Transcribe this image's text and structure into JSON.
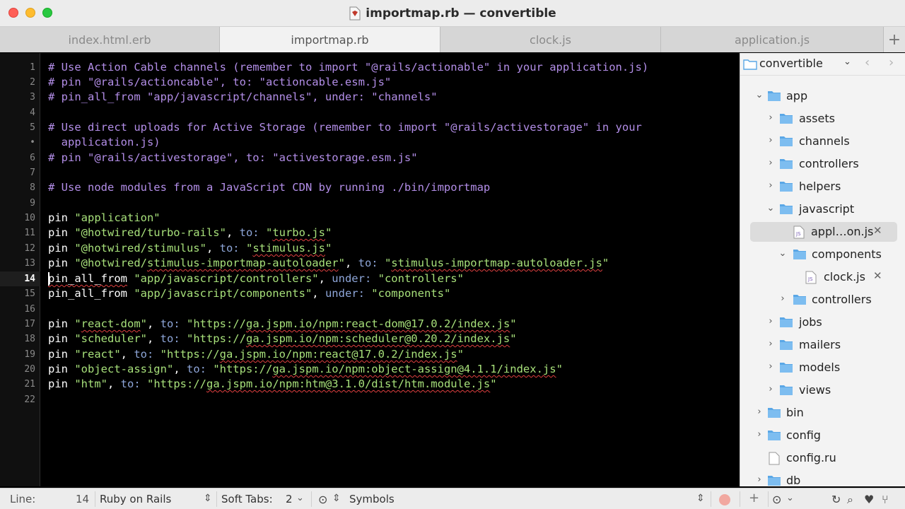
{
  "window": {
    "title": "importmap.rb — convertible"
  },
  "tabs": [
    {
      "label": "index.html.erb",
      "active": false
    },
    {
      "label": "importmap.rb",
      "active": true
    },
    {
      "label": "clock.js",
      "active": false
    },
    {
      "label": "application.js",
      "active": false
    }
  ],
  "tab_add_label": "+",
  "editor": {
    "line_numbers": [
      "1",
      "2",
      "3",
      "4",
      "5",
      "•",
      "6",
      "7",
      "8",
      "9",
      "10",
      "11",
      "12",
      "13",
      "14",
      "15",
      "16",
      "17",
      "18",
      "19",
      "20",
      "21",
      "22"
    ],
    "current_line": "14"
  },
  "sidebar": {
    "project": "convertible",
    "items": [
      {
        "name": "app",
        "type": "folder",
        "expanded": true
      },
      {
        "name": "assets",
        "type": "folder",
        "expanded": false
      },
      {
        "name": "channels",
        "type": "folder",
        "expanded": false
      },
      {
        "name": "controllers",
        "type": "folder",
        "expanded": false
      },
      {
        "name": "helpers",
        "type": "folder",
        "expanded": false
      },
      {
        "name": "javascript",
        "type": "folder",
        "expanded": true
      },
      {
        "name": "appl…on.js",
        "type": "file",
        "selected": true
      },
      {
        "name": "components",
        "type": "folder",
        "expanded": true
      },
      {
        "name": "clock.js",
        "type": "file"
      },
      {
        "name": "controllers",
        "type": "folder",
        "expanded": false
      },
      {
        "name": "jobs",
        "type": "folder",
        "expanded": false
      },
      {
        "name": "mailers",
        "type": "folder",
        "expanded": false
      },
      {
        "name": "models",
        "type": "folder",
        "expanded": false
      },
      {
        "name": "views",
        "type": "folder",
        "expanded": false
      },
      {
        "name": "bin",
        "type": "folder",
        "expanded": false
      },
      {
        "name": "config",
        "type": "folder",
        "expanded": false
      },
      {
        "name": "config.ru",
        "type": "file"
      },
      {
        "name": "db",
        "type": "folder",
        "expanded": false
      }
    ]
  },
  "statusbar": {
    "line_label": "Line:",
    "line_value": "14",
    "language": "Ruby on Rails",
    "soft_tabs_label": "Soft Tabs:",
    "soft_tabs_value": "2",
    "symbols": "Symbols",
    "plus": "+"
  },
  "colors": {
    "comment": "#b38ee8",
    "string": "#a7e07a",
    "symbol": "#8ea6d9",
    "folder": "#5aa7e6"
  }
}
